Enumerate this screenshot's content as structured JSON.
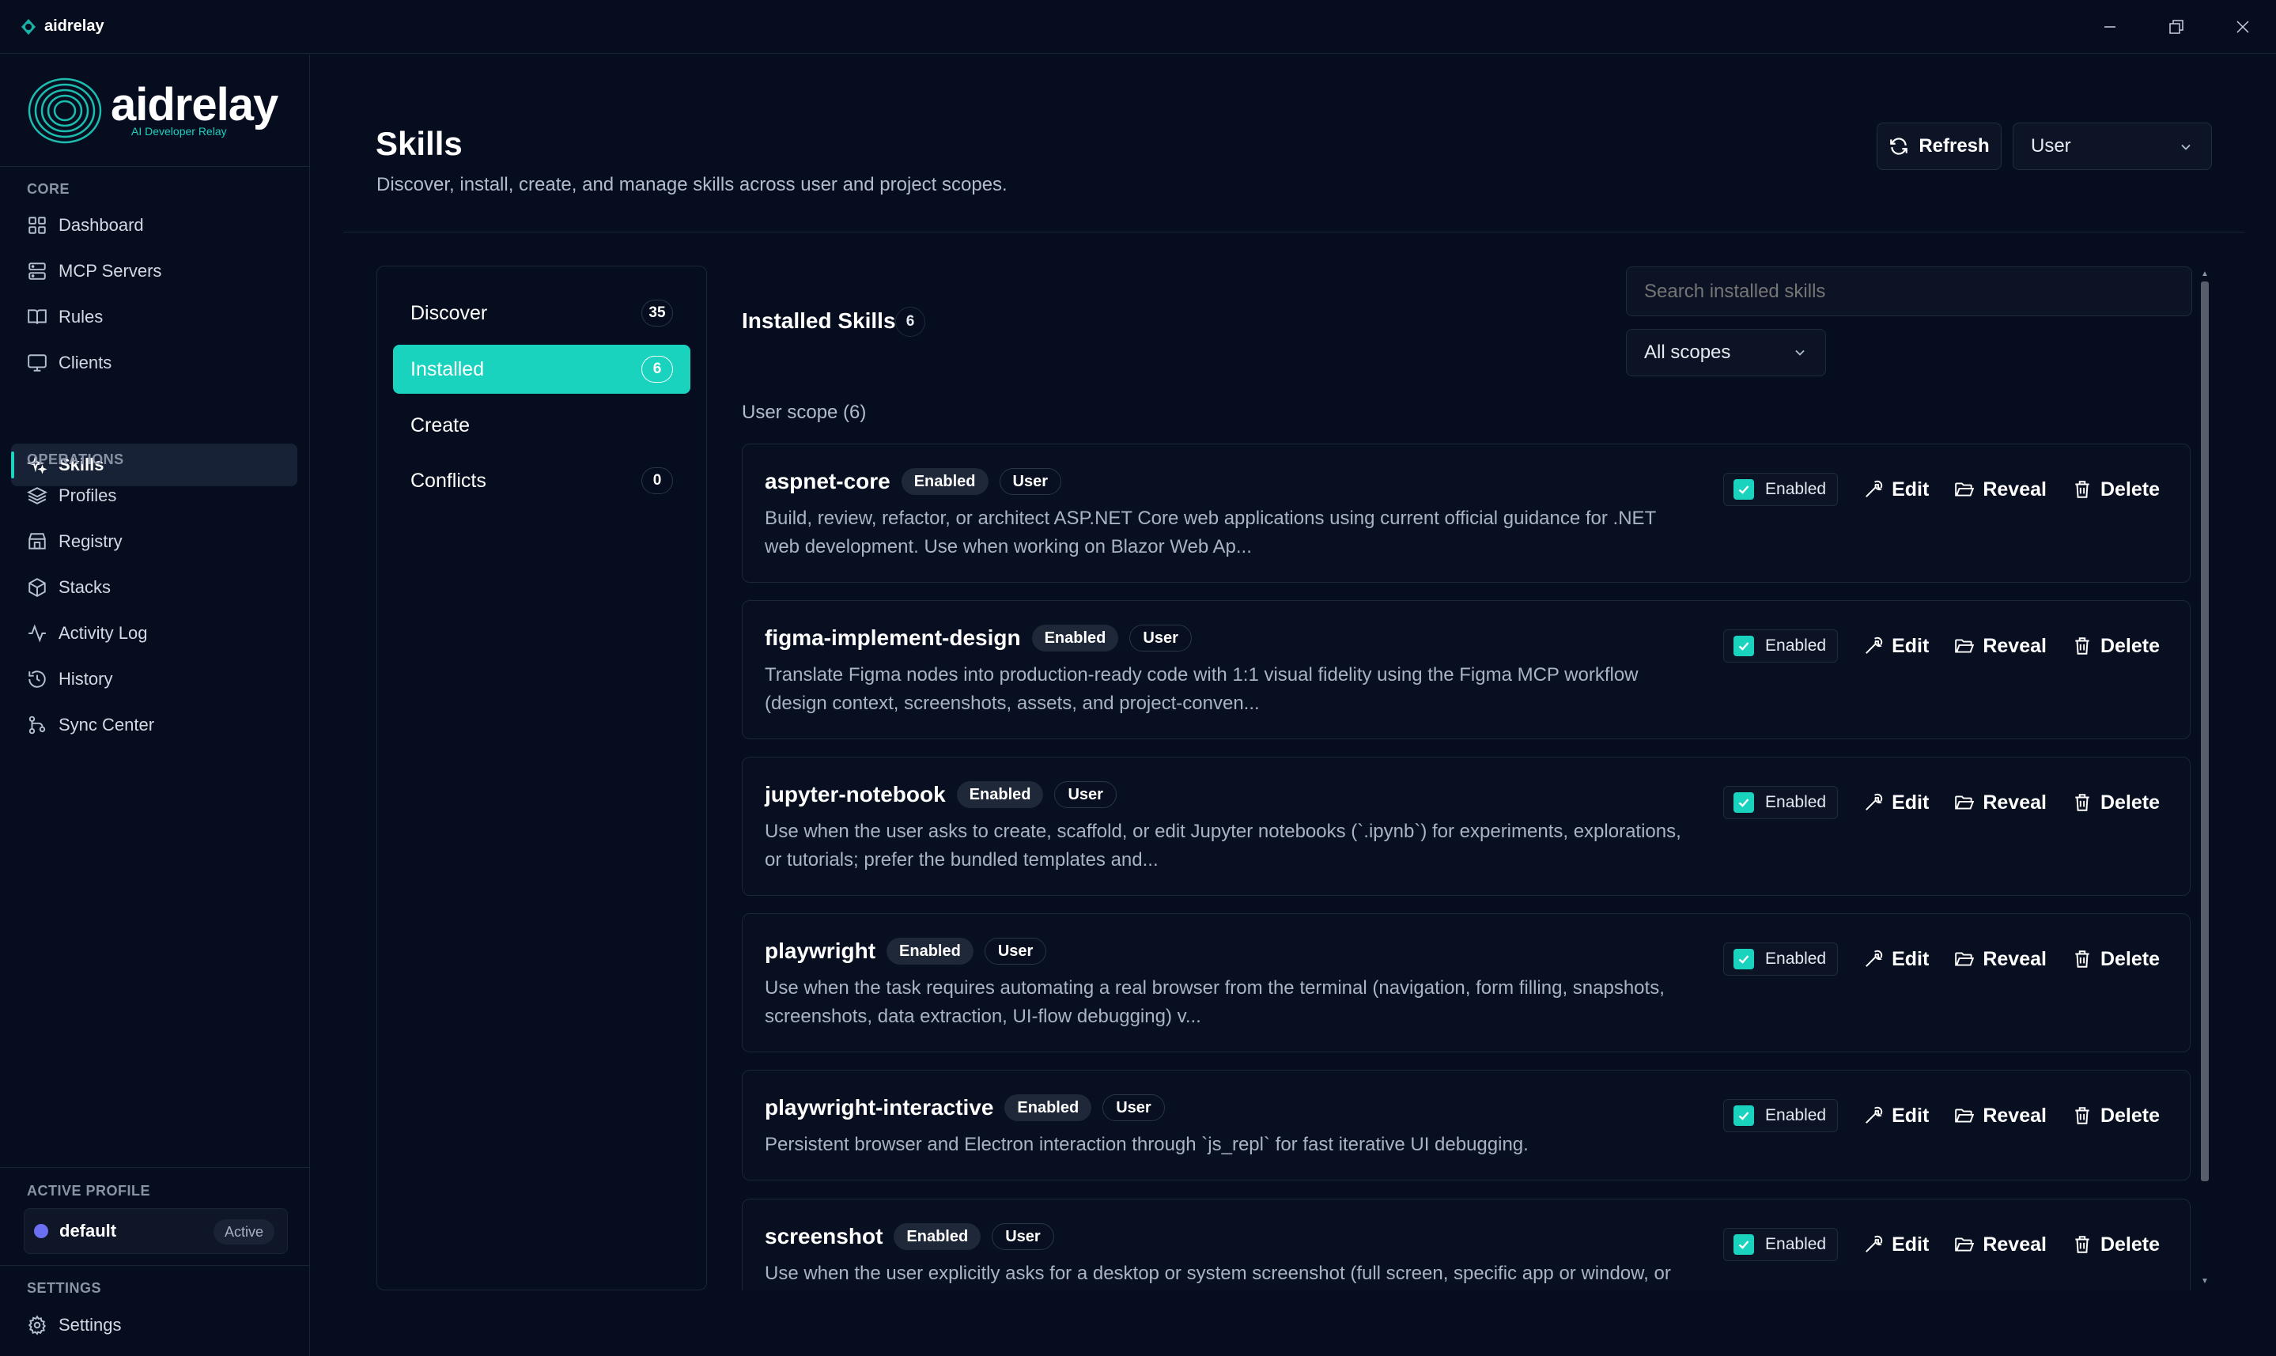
{
  "app": {
    "title": "aidrelay",
    "logo_text": "aidrelay",
    "logo_subtitle": "AI Developer Relay"
  },
  "sidebar": {
    "core_label": "CORE",
    "core_items": [
      {
        "label": "Dashboard",
        "icon": "dashboard-icon"
      },
      {
        "label": "MCP Servers",
        "icon": "server-icon"
      },
      {
        "label": "Rules",
        "icon": "book-icon"
      },
      {
        "label": "Clients",
        "icon": "monitor-icon"
      },
      {
        "label": "Skills",
        "icon": "sparkle-icon",
        "active": true
      }
    ],
    "operations_label": "OPERATIONS",
    "operations_items": [
      {
        "label": "Profiles",
        "icon": "layers-icon"
      },
      {
        "label": "Registry",
        "icon": "registry-icon"
      },
      {
        "label": "Stacks",
        "icon": "package-icon"
      },
      {
        "label": "Activity Log",
        "icon": "activity-icon"
      },
      {
        "label": "History",
        "icon": "history-icon"
      },
      {
        "label": "Sync Center",
        "icon": "git-branch-icon"
      }
    ],
    "active_profile_label": "ACTIVE PROFILE",
    "active_profile": {
      "name": "default",
      "badge": "Active"
    },
    "settings_label": "SETTINGS",
    "settings_item": {
      "label": "Settings",
      "icon": "gear-icon"
    }
  },
  "header": {
    "title": "Skills",
    "subtitle": "Discover, install, create, and manage skills across user and project scopes.",
    "refresh_label": "Refresh",
    "scope_value": "User"
  },
  "subnav": [
    {
      "label": "Discover",
      "count": "35"
    },
    {
      "label": "Installed",
      "count": "6",
      "active": true
    },
    {
      "label": "Create",
      "count": ""
    },
    {
      "label": "Conflicts",
      "count": "0"
    }
  ],
  "installed": {
    "title": "Installed Skills",
    "count": "6",
    "search_placeholder": "Search installed skills",
    "scope_filter": "All scopes",
    "scope_heading": "User scope (6)",
    "enabled_badge": "Enabled",
    "user_badge": "User",
    "toggle_label": "Enabled",
    "edit_label": "Edit",
    "reveal_label": "Reveal",
    "delete_label": "Delete",
    "skills": [
      {
        "name": "aspnet-core",
        "description": "Build, review, refactor, or architect ASP.NET Core web applications using current official guidance for .NET web development. Use when working on Blazor Web Ap...",
        "enabled": true
      },
      {
        "name": "figma-implement-design",
        "description": "Translate Figma nodes into production-ready code with 1:1 visual fidelity using the Figma MCP workflow (design context, screenshots, assets, and project-conven...",
        "enabled": true
      },
      {
        "name": "jupyter-notebook",
        "description": "Use when the user asks to create, scaffold, or edit Jupyter notebooks (`.ipynb`) for experiments, explorations, or tutorials; prefer the bundled templates and...",
        "enabled": true
      },
      {
        "name": "playwright",
        "description": "Use when the task requires automating a real browser from the terminal (navigation, form filling, snapshots, screenshots, data extraction, UI-flow debugging) v...",
        "enabled": true
      },
      {
        "name": "playwright-interactive",
        "description": "Persistent browser and Electron interaction through `js_repl` for fast iterative UI debugging.",
        "enabled": true
      },
      {
        "name": "screenshot",
        "description": "Use when the user explicitly asks for a desktop or system screenshot (full screen, specific app or window, or",
        "enabled": true
      }
    ]
  },
  "colors": {
    "accent": "#19d3be",
    "background": "#060d1e",
    "profile_dot": "#6b6ff2"
  }
}
